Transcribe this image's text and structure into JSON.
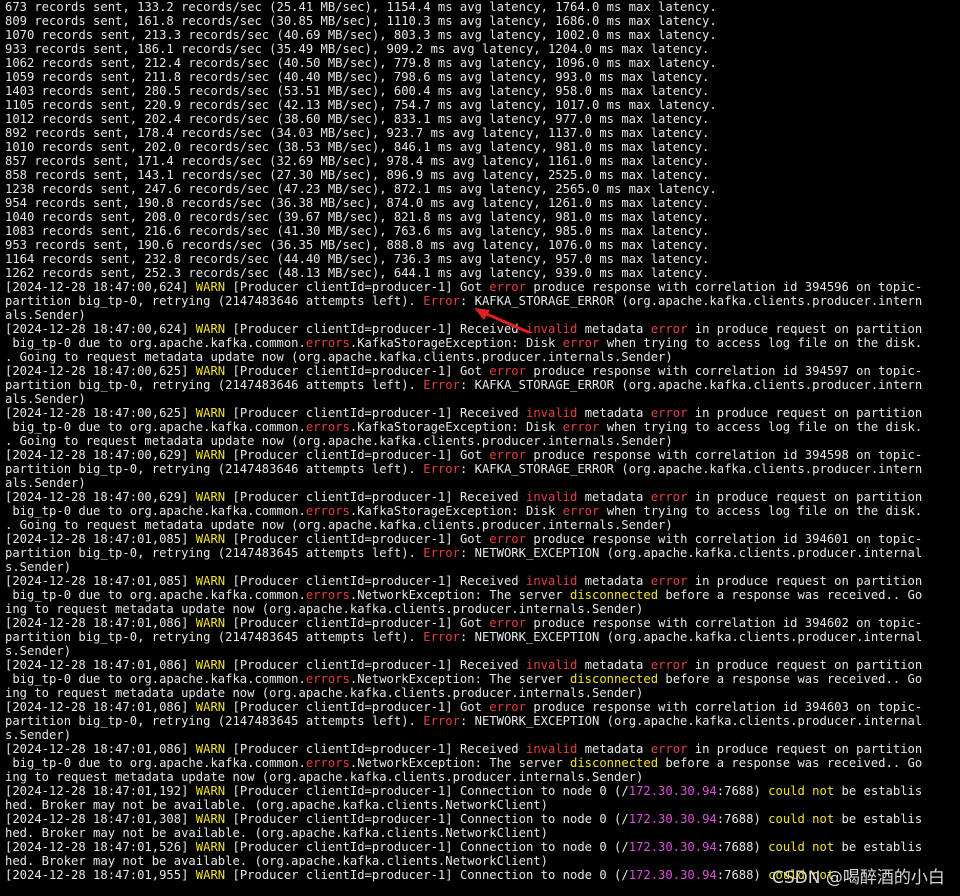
{
  "palette": {
    "background": "#000000",
    "default_text": "#e6e6e6",
    "warn": "#f2e22c",
    "error": "#e04040",
    "ip": "#d950d9"
  },
  "terminal": {
    "lines": [
      [
        {
          "t": "673 records sent, 133.2 records/sec (25.41 MB/sec), 1154.4 ms avg latency, 1764.0 ms max latency."
        }
      ],
      [
        {
          "t": "809 records sent, 161.8 records/sec (30.85 MB/sec), 1110.3 ms avg latency, 1686.0 ms max latency."
        }
      ],
      [
        {
          "t": "1070 records sent, 213.3 records/sec (40.69 MB/sec), 803.3 ms avg latency, 1002.0 ms max latency."
        }
      ],
      [
        {
          "t": "933 records sent, 186.1 records/sec (35.49 MB/sec), 909.2 ms avg latency, 1204.0 ms max latency."
        }
      ],
      [
        {
          "t": "1062 records sent, 212.4 records/sec (40.50 MB/sec), 779.8 ms avg latency, 1096.0 ms max latency."
        }
      ],
      [
        {
          "t": "1059 records sent, 211.8 records/sec (40.40 MB/sec), 798.6 ms avg latency, 993.0 ms max latency."
        }
      ],
      [
        {
          "t": "1403 records sent, 280.5 records/sec (53.51 MB/sec), 600.4 ms avg latency, 958.0 ms max latency."
        }
      ],
      [
        {
          "t": "1105 records sent, 220.9 records/sec (42.13 MB/sec), 754.7 ms avg latency, 1017.0 ms max latency."
        }
      ],
      [
        {
          "t": "1012 records sent, 202.4 records/sec (38.60 MB/sec), 833.1 ms avg latency, 977.0 ms max latency."
        }
      ],
      [
        {
          "t": "892 records sent, 178.4 records/sec (34.03 MB/sec), 923.7 ms avg latency, 1137.0 ms max latency."
        }
      ],
      [
        {
          "t": "1010 records sent, 202.0 records/sec (38.53 MB/sec), 846.1 ms avg latency, 981.0 ms max latency."
        }
      ],
      [
        {
          "t": "857 records sent, 171.4 records/sec (32.69 MB/sec), 978.4 ms avg latency, 1161.0 ms max latency."
        }
      ],
      [
        {
          "t": "858 records sent, 143.1 records/sec (27.30 MB/sec), 896.9 ms avg latency, 2525.0 ms max latency."
        }
      ],
      [
        {
          "t": "1238 records sent, 247.6 records/sec (47.23 MB/sec), 872.1 ms avg latency, 2565.0 ms max latency."
        }
      ],
      [
        {
          "t": "954 records sent, 190.8 records/sec (36.38 MB/sec), 874.0 ms avg latency, 1261.0 ms max latency."
        }
      ],
      [
        {
          "t": "1040 records sent, 208.0 records/sec (39.67 MB/sec), 821.8 ms avg latency, 981.0 ms max latency."
        }
      ],
      [
        {
          "t": "1083 records sent, 216.6 records/sec (41.30 MB/sec), 763.6 ms avg latency, 985.0 ms max latency."
        }
      ],
      [
        {
          "t": "953 records sent, 190.6 records/sec (36.35 MB/sec), 888.8 ms avg latency, 1076.0 ms max latency."
        }
      ],
      [
        {
          "t": "1164 records sent, 232.8 records/sec (44.40 MB/sec), 736.3 ms avg latency, 957.0 ms max latency."
        }
      ],
      [
        {
          "t": "1262 records sent, 252.3 records/sec (48.13 MB/sec), 644.1 ms avg latency, 939.0 ms max latency."
        }
      ],
      [
        {
          "t": "[2024-12-28 18:47:00,624] "
        },
        {
          "t": "WARN",
          "c": "yellow"
        },
        {
          "t": " [Producer clientId=producer-1] Got "
        },
        {
          "t": "error",
          "c": "red"
        },
        {
          "t": " produce response with correlation id 394596 on topic-"
        }
      ],
      [
        {
          "t": "partition big_tp-0, retrying (2147483646 attempts left). "
        },
        {
          "t": "Error",
          "c": "red"
        },
        {
          "t": ": KAFKA_STORAGE_ERROR (org.apache.kafka.clients.producer.intern"
        }
      ],
      [
        {
          "t": "als.Sender)"
        }
      ],
      [
        {
          "t": "[2024-12-28 18:47:00,624] "
        },
        {
          "t": "WARN",
          "c": "yellow"
        },
        {
          "t": " [Producer clientId=producer-1] Received "
        },
        {
          "t": "invalid",
          "c": "red"
        },
        {
          "t": " metadata "
        },
        {
          "t": "error",
          "c": "red"
        },
        {
          "t": " in produce request on partition"
        }
      ],
      [
        {
          "t": " big_tp-0 due to org.apache.kafka.common."
        },
        {
          "t": "errors",
          "c": "red"
        },
        {
          "t": ".KafkaStorageException: Disk "
        },
        {
          "t": "error",
          "c": "red"
        },
        {
          "t": " when trying to access log file on the disk."
        }
      ],
      [
        {
          "t": ". Going to request metadata update now (org.apache.kafka.clients.producer.internals.Sender)"
        }
      ],
      [
        {
          "t": "[2024-12-28 18:47:00,625] "
        },
        {
          "t": "WARN",
          "c": "yellow"
        },
        {
          "t": " [Producer clientId=producer-1] Got "
        },
        {
          "t": "error",
          "c": "red"
        },
        {
          "t": " produce response with correlation id 394597 on topic-"
        }
      ],
      [
        {
          "t": "partition big_tp-0, retrying (2147483646 attempts left). "
        },
        {
          "t": "Error",
          "c": "red"
        },
        {
          "t": ": KAFKA_STORAGE_ERROR (org.apache.kafka.clients.producer.intern"
        }
      ],
      [
        {
          "t": "als.Sender)"
        }
      ],
      [
        {
          "t": "[2024-12-28 18:47:00,625] "
        },
        {
          "t": "WARN",
          "c": "yellow"
        },
        {
          "t": " [Producer clientId=producer-1] Received "
        },
        {
          "t": "invalid",
          "c": "red"
        },
        {
          "t": " metadata "
        },
        {
          "t": "error",
          "c": "red"
        },
        {
          "t": " in produce request on partition"
        }
      ],
      [
        {
          "t": " big_tp-0 due to org.apache.kafka.common."
        },
        {
          "t": "errors",
          "c": "red"
        },
        {
          "t": ".KafkaStorageException: Disk "
        },
        {
          "t": "error",
          "c": "red"
        },
        {
          "t": " when trying to access log file on the disk."
        }
      ],
      [
        {
          "t": ". Going to request metadata update now (org.apache.kafka.clients.producer.internals.Sender)"
        }
      ],
      [
        {
          "t": "[2024-12-28 18:47:00,629] "
        },
        {
          "t": "WARN",
          "c": "yellow"
        },
        {
          "t": " [Producer clientId=producer-1] Got "
        },
        {
          "t": "error",
          "c": "red"
        },
        {
          "t": " produce response with correlation id 394598 on topic-"
        }
      ],
      [
        {
          "t": "partition big_tp-0, retrying (2147483646 attempts left). "
        },
        {
          "t": "Error",
          "c": "red"
        },
        {
          "t": ": KAFKA_STORAGE_ERROR (org.apache.kafka.clients.producer.intern"
        }
      ],
      [
        {
          "t": "als.Sender)"
        }
      ],
      [
        {
          "t": "[2024-12-28 18:47:00,629] "
        },
        {
          "t": "WARN",
          "c": "yellow"
        },
        {
          "t": " [Producer clientId=producer-1] Received "
        },
        {
          "t": "invalid",
          "c": "red"
        },
        {
          "t": " metadata "
        },
        {
          "t": "error",
          "c": "red"
        },
        {
          "t": " in produce request on partition"
        }
      ],
      [
        {
          "t": " big_tp-0 due to org.apache.kafka.common."
        },
        {
          "t": "errors",
          "c": "red"
        },
        {
          "t": ".KafkaStorageException: Disk "
        },
        {
          "t": "error",
          "c": "red"
        },
        {
          "t": " when trying to access log file on the disk."
        }
      ],
      [
        {
          "t": ". Going to request metadata update now (org.apache.kafka.clients.producer.internals.Sender)"
        }
      ],
      [
        {
          "t": "[2024-12-28 18:47:01,085] "
        },
        {
          "t": "WARN",
          "c": "yellow"
        },
        {
          "t": " [Producer clientId=producer-1] Got "
        },
        {
          "t": "error",
          "c": "red"
        },
        {
          "t": " produce response with correlation id 394601 on topic-"
        }
      ],
      [
        {
          "t": "partition big_tp-0, retrying (2147483645 attempts left). "
        },
        {
          "t": "Error",
          "c": "red"
        },
        {
          "t": ": NETWORK_EXCEPTION (org.apache.kafka.clients.producer.internal"
        }
      ],
      [
        {
          "t": "s.Sender)"
        }
      ],
      [
        {
          "t": "[2024-12-28 18:47:01,085] "
        },
        {
          "t": "WARN",
          "c": "yellow"
        },
        {
          "t": " [Producer clientId=producer-1] Received "
        },
        {
          "t": "invalid",
          "c": "red"
        },
        {
          "t": " metadata "
        },
        {
          "t": "error",
          "c": "red"
        },
        {
          "t": " in produce request on partition"
        }
      ],
      [
        {
          "t": " big_tp-0 due to org.apache.kafka.common."
        },
        {
          "t": "errors",
          "c": "red"
        },
        {
          "t": ".NetworkException: The server "
        },
        {
          "t": "disconnected",
          "c": "yellow"
        },
        {
          "t": " before a response was received.. Go"
        }
      ],
      [
        {
          "t": "ing to request metadata update now (org.apache.kafka.clients.producer.internals.Sender)"
        }
      ],
      [
        {
          "t": "[2024-12-28 18:47:01,086] "
        },
        {
          "t": "WARN",
          "c": "yellow"
        },
        {
          "t": " [Producer clientId=producer-1] Got "
        },
        {
          "t": "error",
          "c": "red"
        },
        {
          "t": " produce response with correlation id 394602 on topic-"
        }
      ],
      [
        {
          "t": "partition big_tp-0, retrying (2147483645 attempts left). "
        },
        {
          "t": "Error",
          "c": "red"
        },
        {
          "t": ": NETWORK_EXCEPTION (org.apache.kafka.clients.producer.internal"
        }
      ],
      [
        {
          "t": "s.Sender)"
        }
      ],
      [
        {
          "t": "[2024-12-28 18:47:01,086] "
        },
        {
          "t": "WARN",
          "c": "yellow"
        },
        {
          "t": " [Producer clientId=producer-1] Received "
        },
        {
          "t": "invalid",
          "c": "red"
        },
        {
          "t": " metadata "
        },
        {
          "t": "error",
          "c": "red"
        },
        {
          "t": " in produce request on partition"
        }
      ],
      [
        {
          "t": " big_tp-0 due to org.apache.kafka.common."
        },
        {
          "t": "errors",
          "c": "red"
        },
        {
          "t": ".NetworkException: The server "
        },
        {
          "t": "disconnected",
          "c": "yellow"
        },
        {
          "t": " before a response was received.. Go"
        }
      ],
      [
        {
          "t": "ing to request metadata update now (org.apache.kafka.clients.producer.internals.Sender)"
        }
      ],
      [
        {
          "t": "[2024-12-28 18:47:01,086] "
        },
        {
          "t": "WARN",
          "c": "yellow"
        },
        {
          "t": " [Producer clientId=producer-1] Got "
        },
        {
          "t": "error",
          "c": "red"
        },
        {
          "t": " produce response with correlation id 394603 on topic-"
        }
      ],
      [
        {
          "t": "partition big_tp-0, retrying (2147483645 attempts left). "
        },
        {
          "t": "Error",
          "c": "red"
        },
        {
          "t": ": NETWORK_EXCEPTION (org.apache.kafka.clients.producer.internal"
        }
      ],
      [
        {
          "t": "s.Sender)"
        }
      ],
      [
        {
          "t": "[2024-12-28 18:47:01,086] "
        },
        {
          "t": "WARN",
          "c": "yellow"
        },
        {
          "t": " [Producer clientId=producer-1] Received "
        },
        {
          "t": "invalid",
          "c": "red"
        },
        {
          "t": " metadata "
        },
        {
          "t": "error",
          "c": "red"
        },
        {
          "t": " in produce request on partition"
        }
      ],
      [
        {
          "t": " big_tp-0 due to org.apache.kafka.common."
        },
        {
          "t": "errors",
          "c": "red"
        },
        {
          "t": ".NetworkException: The server "
        },
        {
          "t": "disconnected",
          "c": "yellow"
        },
        {
          "t": " before a response was received.. Go"
        }
      ],
      [
        {
          "t": "ing to request metadata update now (org.apache.kafka.clients.producer.internals.Sender)"
        }
      ],
      [
        {
          "t": "[2024-12-28 18:47:01,192] "
        },
        {
          "t": "WARN",
          "c": "yellow"
        },
        {
          "t": " [Producer clientId=producer-1] Connection to node 0 (/"
        },
        {
          "t": "172.30.30.94",
          "c": "magenta"
        },
        {
          "t": ":7688) "
        },
        {
          "t": "could not",
          "c": "yellow"
        },
        {
          "t": " be establis"
        }
      ],
      [
        {
          "t": "hed. Broker may not be available. (org.apache.kafka.clients.NetworkClient)"
        }
      ],
      [
        {
          "t": "[2024-12-28 18:47:01,308] "
        },
        {
          "t": "WARN",
          "c": "yellow"
        },
        {
          "t": " [Producer clientId=producer-1] Connection to node 0 (/"
        },
        {
          "t": "172.30.30.94",
          "c": "magenta"
        },
        {
          "t": ":7688) "
        },
        {
          "t": "could not",
          "c": "yellow"
        },
        {
          "t": " be establis"
        }
      ],
      [
        {
          "t": "hed. Broker may not be available. (org.apache.kafka.clients.NetworkClient)"
        }
      ],
      [
        {
          "t": "[2024-12-28 18:47:01,526] "
        },
        {
          "t": "WARN",
          "c": "yellow"
        },
        {
          "t": " [Producer clientId=producer-1] Connection to node 0 (/"
        },
        {
          "t": "172.30.30.94",
          "c": "magenta"
        },
        {
          "t": ":7688) "
        },
        {
          "t": "could not",
          "c": "yellow"
        },
        {
          "t": " be establis"
        }
      ],
      [
        {
          "t": "hed. Broker may not be available. (org.apache.kafka.clients.NetworkClient)"
        }
      ],
      [
        {
          "t": "[2024-12-28 18:47:01,955] "
        },
        {
          "t": "WARN",
          "c": "yellow"
        },
        {
          "t": " [Producer clientId=producer-1] Connection to node 0 (/"
        },
        {
          "t": "172.30.30.94",
          "c": "magenta"
        },
        {
          "t": ":7688) "
        },
        {
          "t": "could not",
          "c": "yellow"
        }
      ]
    ]
  },
  "watermark": {
    "text": "CSDN @喝醉酒的小白"
  },
  "annotation": {
    "icon": "red-arrow-icon",
    "color": "#e02020"
  }
}
